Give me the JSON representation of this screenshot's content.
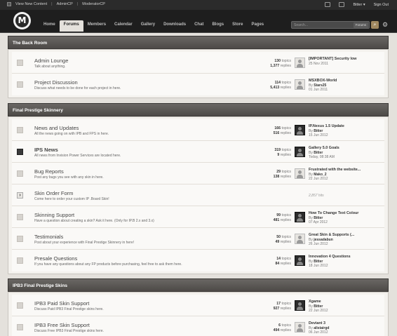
{
  "topbar": {
    "view_new": "View New Content",
    "admincp": "AdminCP",
    "modcp": "ModeratorCP",
    "user": "Bitter",
    "signout": "Sign Out"
  },
  "header": {
    "logo_letter": "M",
    "nav": [
      "Home",
      "Forums",
      "Members",
      "Calendar",
      "Gallery",
      "Downloads",
      "Chat",
      "Blogs",
      "Store",
      "Pages"
    ],
    "active_tab": "Forums",
    "search_placeholder": "Search...",
    "search_scope": "Forums"
  },
  "categories": [
    {
      "title": "The Back Room",
      "forums": [
        {
          "name": "Admin Lounge",
          "desc": "Talk about anything.",
          "topics": "130",
          "replies": "1,377",
          "status": "read",
          "last": {
            "title": "[IMPORTANT] Security low",
            "by": "",
            "date": "25 Nov 2011",
            "avatar": "light"
          }
        },
        {
          "name": "Project Discussion",
          "desc": "Discuss what needs to be done for each project in here.",
          "topics": "114",
          "replies": "5,413",
          "status": "read",
          "last": {
            "title": "MSXBOX-World",
            "by": "Stars25",
            "date": "01 Jun 2011",
            "avatar": "light"
          }
        }
      ]
    },
    {
      "title": "Final Prestige Skinnery",
      "forums": [
        {
          "name": "News and Updates",
          "desc": "All the news going on with IPB and FPS in here.",
          "topics": "166",
          "replies": "516",
          "status": "read",
          "last": {
            "title": "IP.Nexus 1.5 Update",
            "by": "Bitter",
            "date": "15 Jun 2012",
            "avatar": "dark"
          }
        },
        {
          "name": "IPS News",
          "desc": "All news from Invision Power Services are located here.",
          "topics": "319",
          "replies": "9",
          "status": "dark",
          "bold": true,
          "last": {
            "title": "Gallery 5.0 Goals",
            "by": "Bitter",
            "date": "Today, 08:38 AM",
            "avatar": "dark"
          }
        },
        {
          "name": "Bug Reports",
          "desc": "Post any bugs you see with any skin in here.",
          "topics": "29",
          "replies": "138",
          "status": "read",
          "last": {
            "title": "Frustrated with the website...",
            "by": "Mako_2",
            "date": "22 Jun 2012",
            "avatar": "light"
          }
        },
        {
          "name": "Skin Order Form",
          "desc": "Come here to order your custom IP .Board Skin!",
          "topics": "",
          "replies": "",
          "status": "arrow",
          "redirect": "2,857 hits"
        },
        {
          "name": "Skinning Support",
          "desc": "Have a question about creating a skin? Ask it here. (Only for IP.B 2.x and 3.x)",
          "topics": "99",
          "replies": "481",
          "status": "read",
          "last": {
            "title": "How To Change Text Colour",
            "by": "Bitter",
            "date": "07 Apr 2012",
            "avatar": "dark"
          }
        },
        {
          "name": "Testimonials",
          "desc": "Post about your experience with Final Prestige Skinnery in here!",
          "topics": "50",
          "replies": "49",
          "status": "read",
          "last": {
            "title": "Great Skin & Supports (...",
            "by": "jessadabun",
            "date": "26 Jun 2012",
            "avatar": "light"
          }
        },
        {
          "name": "Presale Questions",
          "desc": "If you have any questions about any FP products before purchasing, feel free to ask them here.",
          "topics": "14",
          "replies": "84",
          "status": "read",
          "last": {
            "title": "Innovation 4 Questions",
            "by": "Bitter",
            "date": "18 Jun 2012",
            "avatar": "dark"
          }
        }
      ]
    },
    {
      "title": "IPB3 Final Prestige Skins",
      "forums": [
        {
          "name": "IPB3 Paid Skin Support",
          "desc": "Discuss Paid IPB3 Final Prestige skins here.",
          "topics": "17",
          "replies": "927",
          "status": "read",
          "last": {
            "title": "Xgame",
            "by": "Bitter",
            "date": "22 Jun 2012",
            "avatar": "dark"
          }
        },
        {
          "name": "IPB3 Free Skin Support",
          "desc": "Discuss Free IPB3 Final Prestige skins here.",
          "topics": "6",
          "replies": "494",
          "status": "read",
          "last": {
            "title": "Deviant 3",
            "by": "alistairgd",
            "date": "06 Jun 2012",
            "avatar": "light"
          }
        }
      ]
    }
  ],
  "labels": {
    "topics": "topics",
    "replies": "replies",
    "by": "By"
  }
}
